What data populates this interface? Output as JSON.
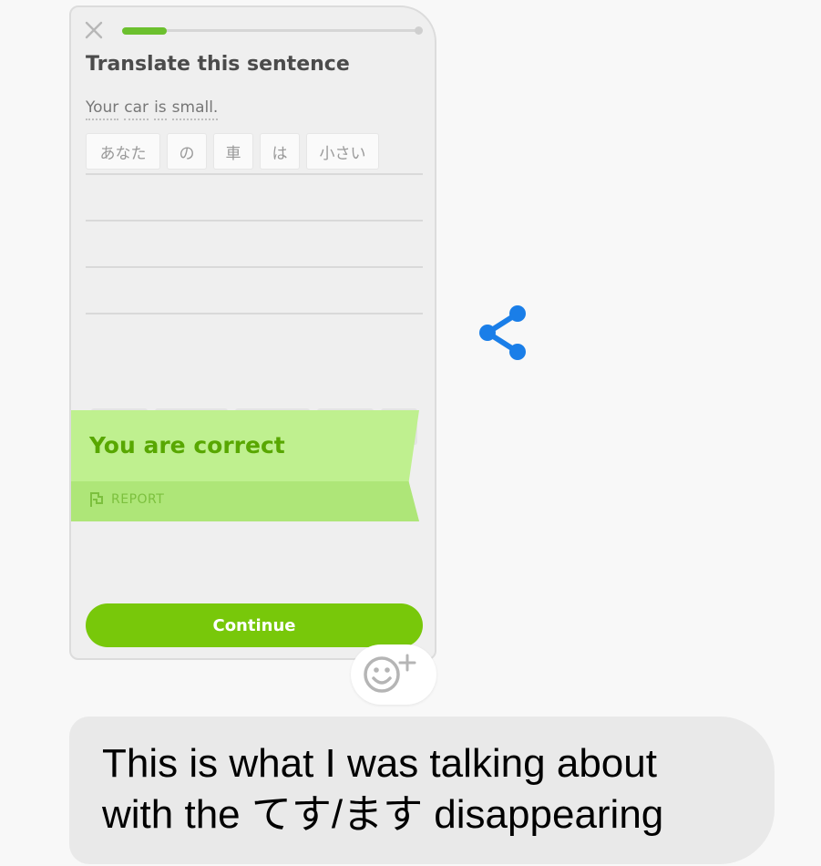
{
  "lesson": {
    "prompt": "Translate this sentence",
    "sentence_words": [
      "Your",
      "car",
      "is",
      "small."
    ],
    "answer_tiles": [
      "あなた",
      "の",
      "車",
      "は",
      "小さい"
    ],
    "progress": 0.15,
    "result_title": "You are correct",
    "report_label": "REPORT",
    "continue_label": "Continue"
  },
  "message": {
    "text": "This is what I was talking about\nwith the てす/ます disappearing"
  },
  "icons": {
    "close": "close-icon",
    "share": "share-icon",
    "add_reaction": "add-reaction-icon",
    "flag": "flag-icon"
  },
  "colors": {
    "accent_green": "#78c80a",
    "banner_green": "#bff08f",
    "share_blue": "#1a7ee8"
  }
}
